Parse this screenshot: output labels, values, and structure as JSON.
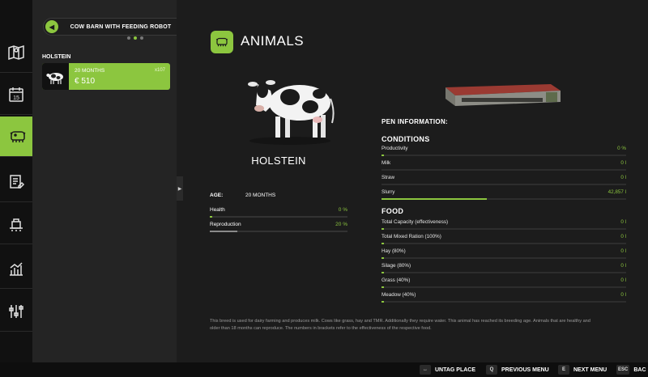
{
  "sidebar": {
    "items": [
      {
        "icon": "map-icon"
      },
      {
        "icon": "calendar-icon",
        "label": "15"
      },
      {
        "icon": "cow-icon",
        "active": true
      },
      {
        "icon": "contracts-icon"
      },
      {
        "icon": "production-icon"
      },
      {
        "icon": "statistics-icon"
      },
      {
        "icon": "settings-icon"
      }
    ]
  },
  "list": {
    "selector_title": "COW BARN WITH FEEDING ROBOT",
    "group_label": "HOLSTEIN",
    "item": {
      "age": "20 MONTHS",
      "price": "€ 510",
      "count": "x107"
    }
  },
  "detail": {
    "section_title": "ANIMALS",
    "breed_name": "HOLSTEIN",
    "age_label": "AGE:",
    "age_value": "20 MONTHS",
    "stats": [
      {
        "label": "Health",
        "value": "0 %",
        "fraction": 0.02
      },
      {
        "label": "Reproduction",
        "value": "20 %",
        "fraction": 0.2
      }
    ],
    "pen_info_label": "PEN INFORMATION:",
    "conditions_label": "CONDITIONS",
    "conditions": [
      {
        "label": "Productivity",
        "value": "0 %",
        "fraction": 0.01
      },
      {
        "label": "Milk",
        "value": "0 l",
        "fraction": 0.0
      },
      {
        "label": "Straw",
        "value": "0 l",
        "fraction": 0.0
      },
      {
        "label": "Slurry",
        "value": "42,857 l",
        "fraction": 0.43
      }
    ],
    "food_label": "FOOD",
    "food": [
      {
        "label": "Total Capacity (effectiveness)",
        "value": "0 l",
        "fraction": 0.01
      },
      {
        "label": "Total Mixed Ration (100%)",
        "value": "0 l",
        "fraction": 0.01
      },
      {
        "label": "Hay (80%)",
        "value": "0 l",
        "fraction": 0.01
      },
      {
        "label": "Silage (80%)",
        "value": "0 l",
        "fraction": 0.01
      },
      {
        "label": "Grass (40%)",
        "value": "0 l",
        "fraction": 0.01
      },
      {
        "label": "Meadow (40%)",
        "value": "0 l",
        "fraction": 0.01
      }
    ],
    "description": "This breed is used for dairy farming and produces milk. Cows like grass, hay and TMR. Additionally they require water. This animal has reached its breeding age. Animals that are healthy and older than 18 months can reproduce. The numbers in brackets refer to the effectiveness of the respective food."
  },
  "bottom_bar": {
    "hints": [
      {
        "key": "↔",
        "label": "UNTAG PLACE"
      },
      {
        "key": "Q",
        "label": "PREVIOUS MENU"
      },
      {
        "key": "E",
        "label": "NEXT MENU"
      },
      {
        "key": "ESC",
        "label": "BAC"
      }
    ]
  },
  "colors": {
    "accent": "#8cc63f",
    "background": "#1c1c1c",
    "panel": "#242424",
    "rail": "#111111"
  }
}
